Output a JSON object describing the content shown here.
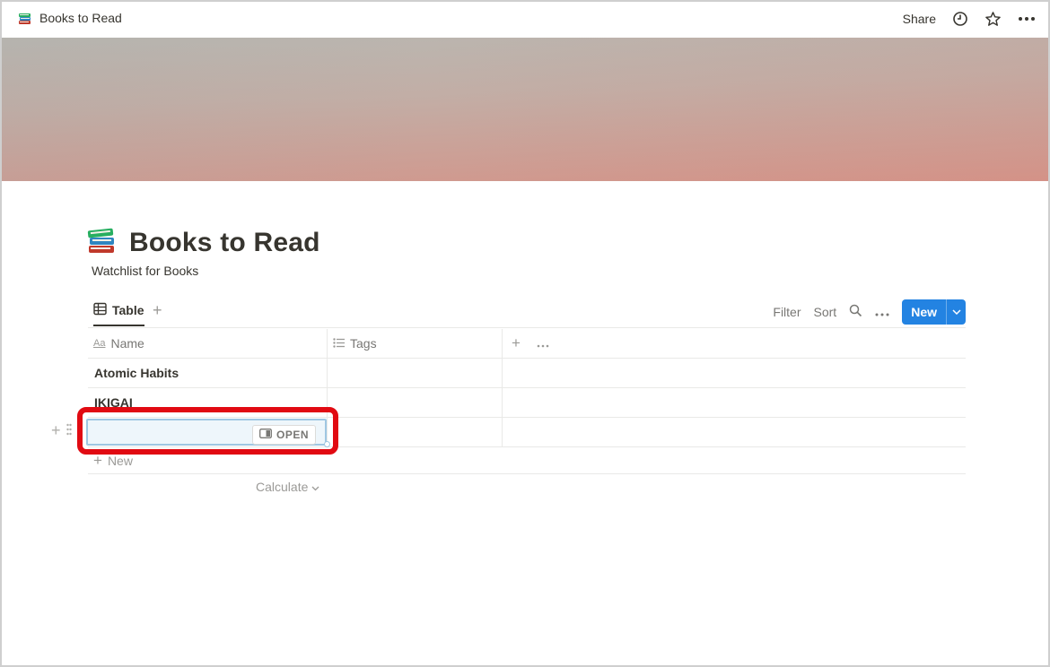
{
  "topbar": {
    "page_title": "Books to Read",
    "share_label": "Share"
  },
  "page": {
    "title": "Books to Read",
    "description": "Watchlist for Books"
  },
  "view": {
    "tab_label": "Table",
    "filter_label": "Filter",
    "sort_label": "Sort",
    "new_label": "New"
  },
  "table": {
    "columns": [
      {
        "label": "Name",
        "icon": "text-property-icon"
      },
      {
        "label": "Tags",
        "icon": "list-property-icon"
      }
    ],
    "rows": [
      {
        "name": "Atomic Habits",
        "tags": ""
      },
      {
        "name": "IKIGAI",
        "tags": ""
      },
      {
        "name": "",
        "tags": ""
      }
    ],
    "open_label": "OPEN",
    "new_row_label": "New",
    "calculate_label": "Calculate"
  },
  "colors": {
    "accent": "#2383e2",
    "highlight": "#e10a12",
    "selection": "#eef6fb"
  }
}
